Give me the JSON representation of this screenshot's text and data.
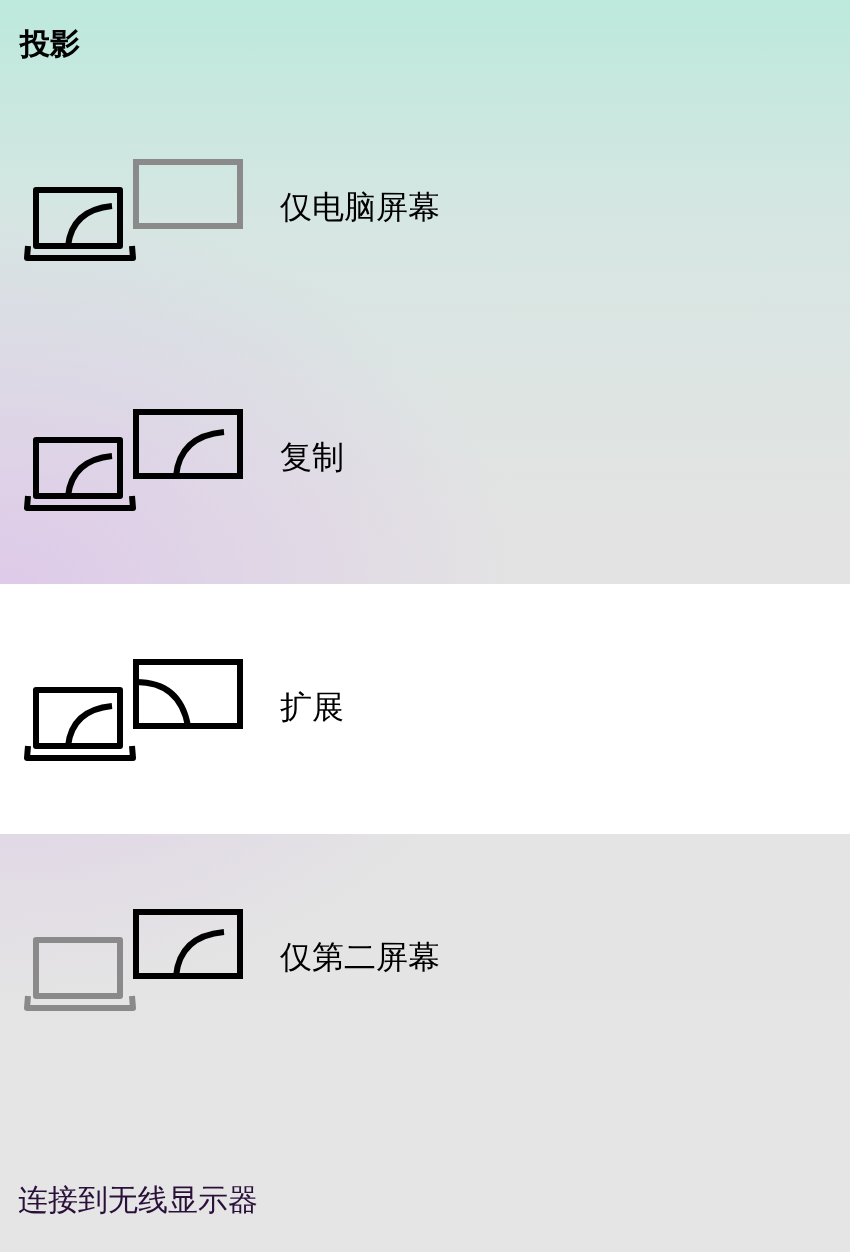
{
  "title": "投影",
  "options": [
    {
      "kind": "pc_only",
      "label": "仅电脑屏幕",
      "selected": false
    },
    {
      "kind": "duplicate",
      "label": "复制",
      "selected": false
    },
    {
      "kind": "extend",
      "label": "扩展",
      "selected": true
    },
    {
      "kind": "second_only",
      "label": "仅第二屏幕",
      "selected": false
    }
  ],
  "link": "连接到无线显示器"
}
